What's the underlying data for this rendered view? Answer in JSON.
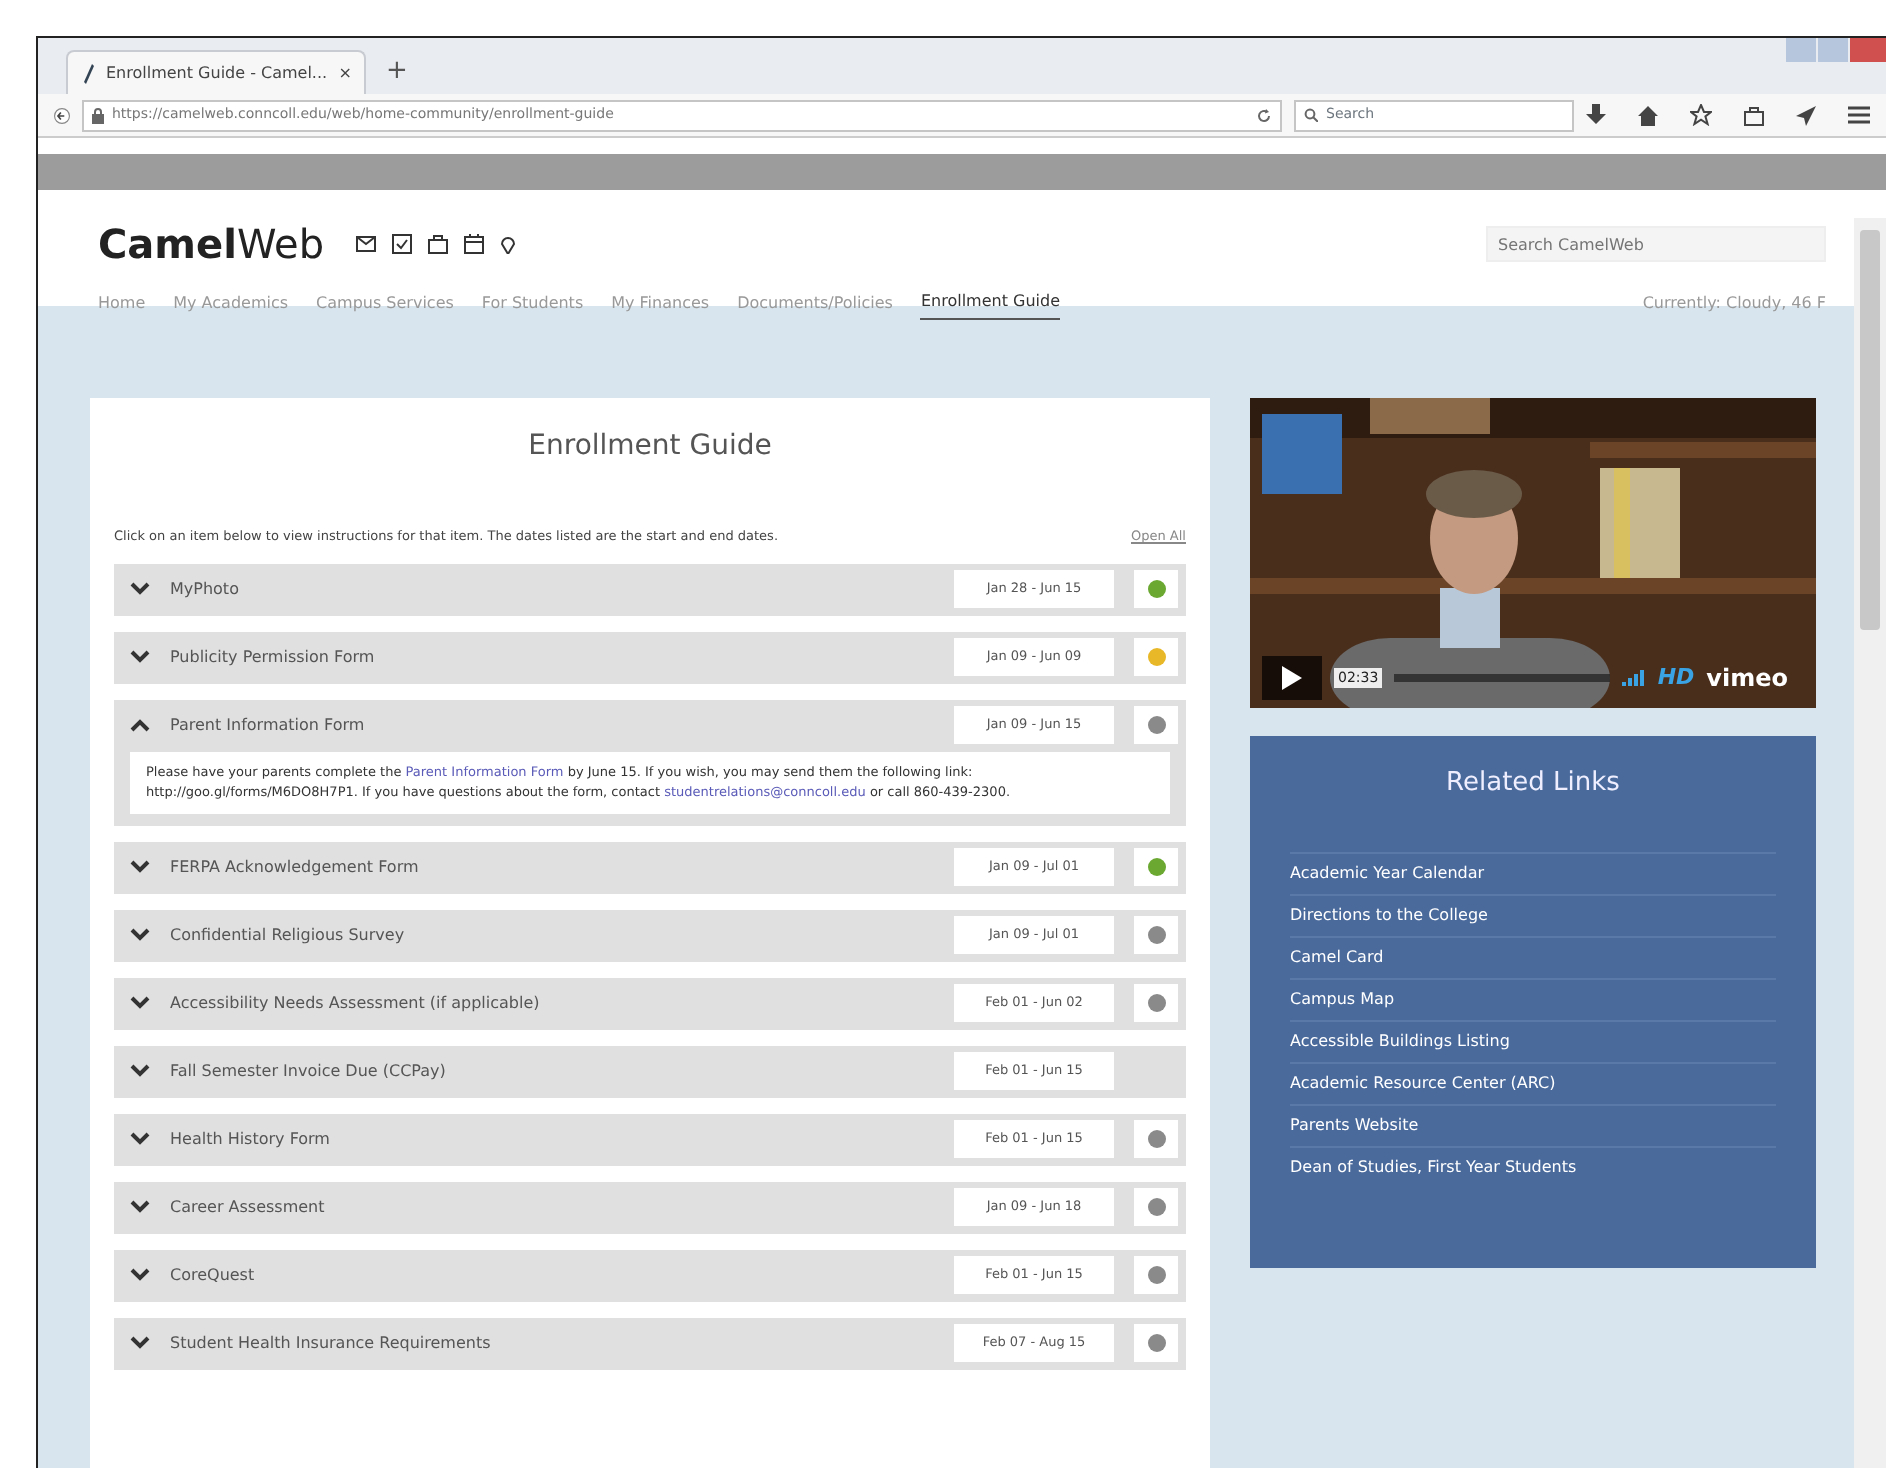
{
  "browser": {
    "tab_title": "Enrollment Guide - Camel...",
    "tab_close": "×",
    "new_tab": "+",
    "url": "https://camelweb.conncoll.edu/web/home-community/enrollment-guide",
    "search_placeholder": "Search"
  },
  "site": {
    "logo_bold": "Camel",
    "logo_rest": "Web",
    "search_placeholder": "Search CamelWeb",
    "weather": "Currently: Cloudy, 46 F",
    "nav": [
      {
        "label": "Home",
        "selected": false
      },
      {
        "label": "My Academics",
        "selected": false
      },
      {
        "label": "Campus Services",
        "selected": false
      },
      {
        "label": "For Students",
        "selected": false
      },
      {
        "label": "My Finances",
        "selected": false
      },
      {
        "label": "Documents/Policies",
        "selected": false
      },
      {
        "label": "Enrollment Guide",
        "selected": true
      }
    ]
  },
  "guide": {
    "title": "Enrollment Guide",
    "instructions": "Click on an item below to view instructions for that item. The dates listed are the start and end dates.",
    "open_all": "Open All",
    "items": [
      {
        "title": "MyPhoto",
        "dates": "Jan 28 - Jun 15",
        "color": "#6aa832",
        "expanded": false
      },
      {
        "title": "Publicity Permission Form",
        "dates": "Jan 09 - Jun 09",
        "color": "#e8b828",
        "expanded": false
      },
      {
        "title": "Parent Information Form",
        "dates": "Jan 09 - Jun 15",
        "color": "#8a8a8a",
        "expanded": true,
        "details": [
          {
            "kind": "text",
            "text": "Please have your parents complete the"
          },
          {
            "kind": "link",
            "text": "Parent Information Form"
          },
          {
            "kind": "text",
            "text": "by June 15. If you wish, you may send them the following link: http://goo.gl/forms/M6DO8H7P1. If you have questions about the form, contact"
          },
          {
            "kind": "link",
            "text": "studentrelations@conncoll.edu"
          },
          {
            "kind": "text",
            "text": "or call 860-439-2300."
          }
        ]
      },
      {
        "title": "FERPA Acknowledgement Form",
        "dates": "Jan 09 - Jul 01",
        "color": "#6aa832",
        "expanded": false
      },
      {
        "title": "Confidential Religious Survey",
        "dates": "Jan 09 - Jul 01",
        "color": "#8a8a8a",
        "expanded": false
      },
      {
        "title": "Accessibility Needs Assessment (if applicable)",
        "dates": "Feb 01 - Jun 02",
        "color": "#8a8a8a",
        "expanded": false
      },
      {
        "title": "Fall Semester Invoice Due (CCPay)",
        "dates": "Feb 01 - Jun 15",
        "expanded": false
      },
      {
        "title": "Health History Form",
        "dates": "Feb 01 - Jun 15",
        "color": "#8a8a8a",
        "expanded": false
      },
      {
        "title": "Career Assessment",
        "dates": "Jan 09 - Jun 18",
        "color": "#8a8a8a",
        "expanded": false
      },
      {
        "title": "CoreQuest",
        "dates": "Feb 01 - Jun 15",
        "color": "#8a8a8a",
        "expanded": false
      },
      {
        "title": "Student Health Insurance Requirements",
        "dates": "Feb 07 - Aug 15",
        "color": "#8a8a8a",
        "expanded": false
      }
    ]
  },
  "video": {
    "time": "02:33",
    "hd": "HD",
    "brand": "vimeo"
  },
  "related": {
    "title": "Related Links",
    "links": [
      "Academic Year Calendar",
      "Directions to the College",
      "Camel Card",
      "Campus Map",
      "Accessible Buildings Listing",
      "Academic Resource Center (ARC)",
      "Parents Website",
      "Dean of Studies, First Year Students"
    ]
  }
}
